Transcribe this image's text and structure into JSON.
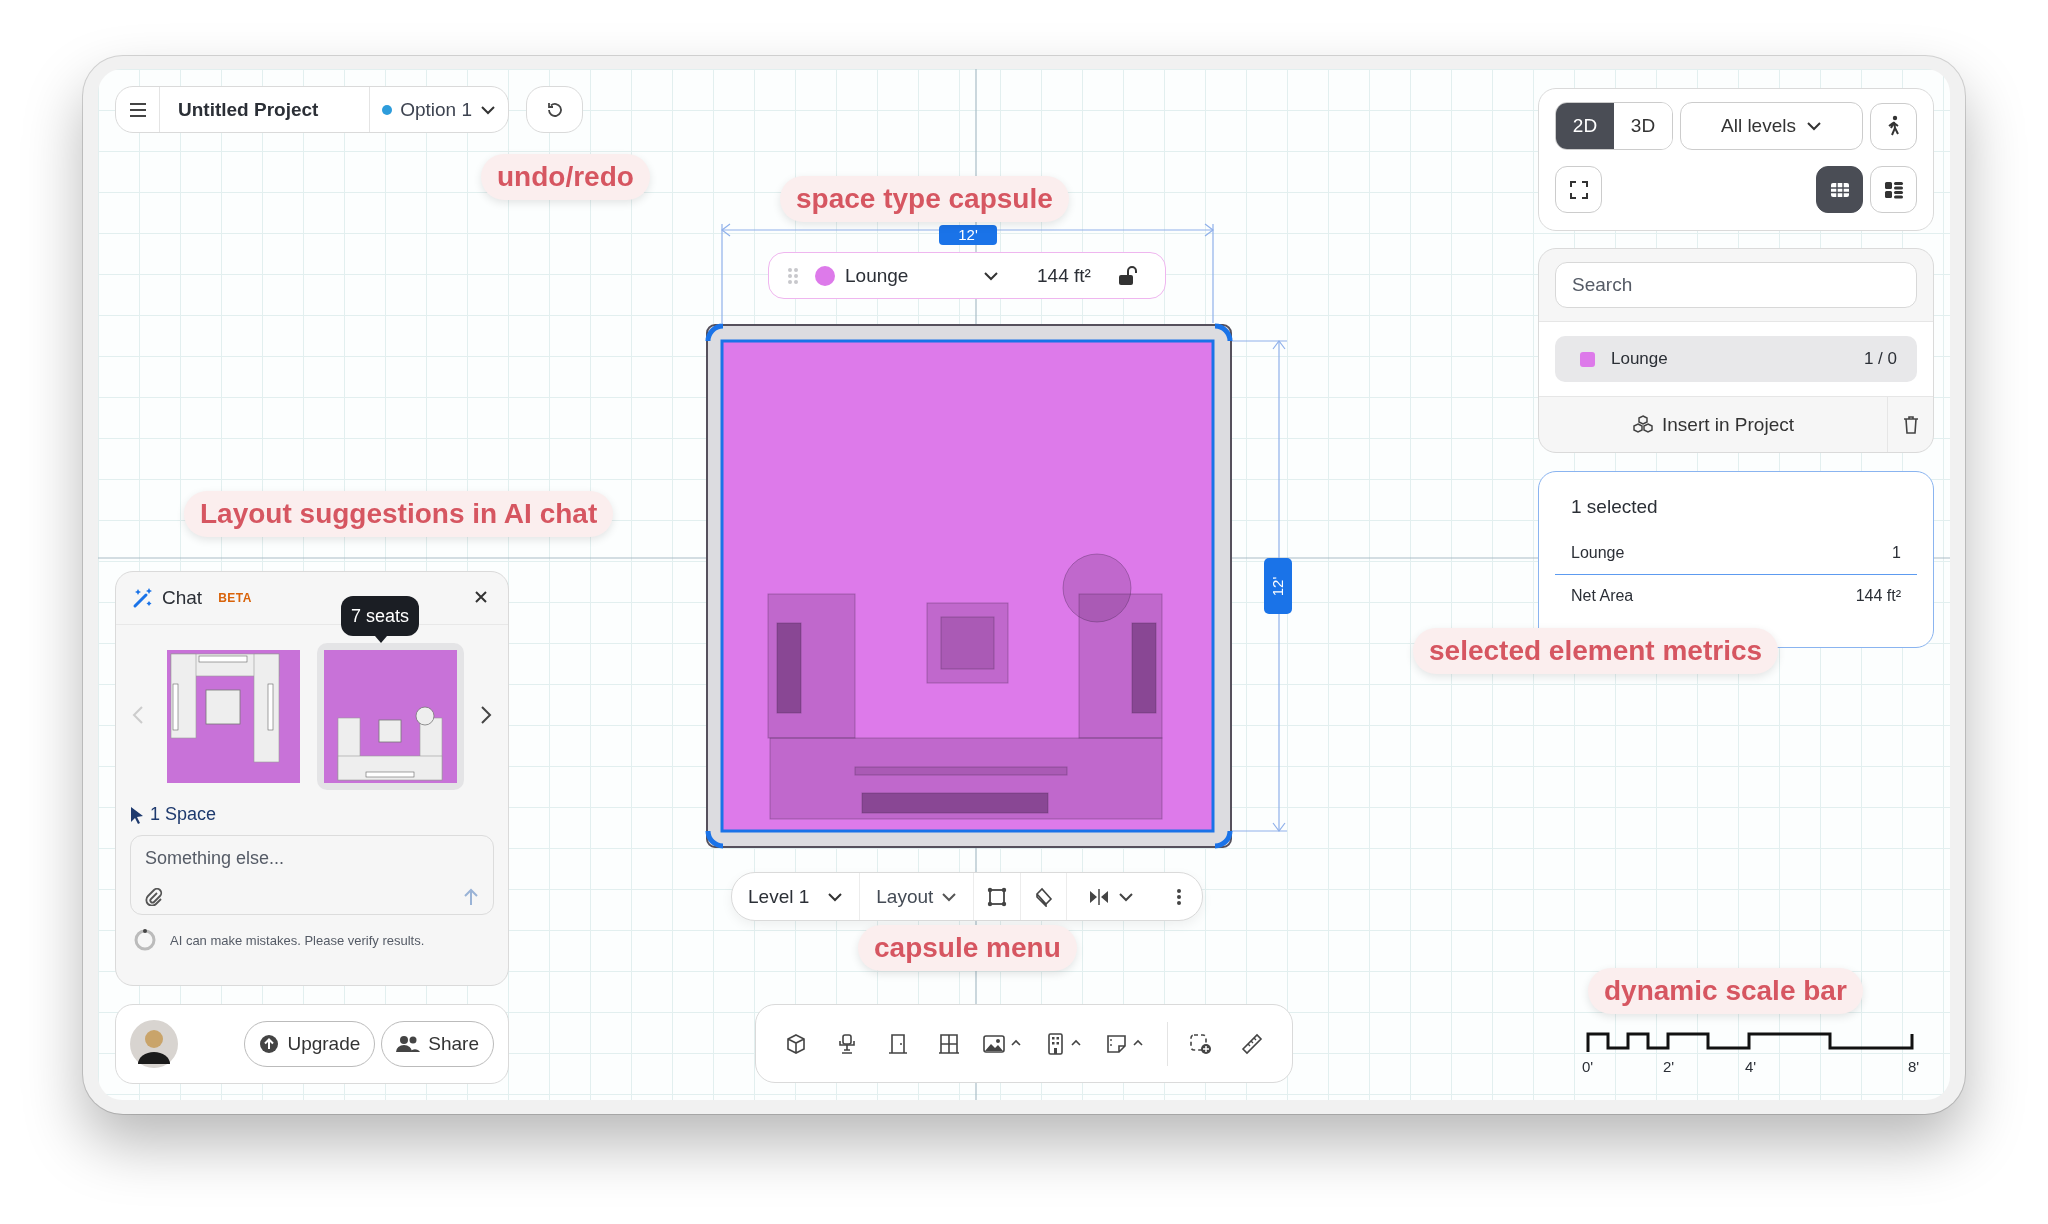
{
  "header": {
    "title": "Untitled Project",
    "option": "Option 1"
  },
  "annotations": [
    {
      "text": "undo/redo"
    },
    {
      "text": "space type capsule"
    },
    {
      "text": "Layout suggestions in AI chat"
    },
    {
      "text": "capsule menu"
    },
    {
      "text": "selected element metrics"
    },
    {
      "text": "dynamic scale bar"
    }
  ],
  "space_capsule": {
    "space_type": "Lounge",
    "color": "#dd7aea",
    "area": "144 ft²",
    "locked": false
  },
  "dimensions": {
    "width": "12'",
    "depth": "12'"
  },
  "view_panel": {
    "modes": [
      {
        "label": "2D",
        "selected": true
      },
      {
        "label": "3D",
        "selected": false
      }
    ],
    "level_filter": "All levels",
    "layouts": [
      {
        "kind": "grid",
        "selected": true
      },
      {
        "kind": "list",
        "selected": false
      }
    ]
  },
  "library": {
    "search_placeholder": "Search",
    "items": [
      {
        "name": "Lounge",
        "color": "#dd7aea",
        "count": "1 / 0",
        "selected": true
      }
    ],
    "insert_label": "Insert in Project"
  },
  "selection": {
    "title": "1 selected",
    "rows": [
      {
        "label": "Lounge",
        "value": "1"
      },
      {
        "label": "Net Area",
        "value": "144 ft²"
      }
    ]
  },
  "chat": {
    "title": "Chat",
    "badge": "BETA",
    "previous_disabled": true,
    "suggestions": [
      {
        "selected": false
      },
      {
        "selected": true,
        "tooltip": "7 seats"
      }
    ],
    "context": "1 Space",
    "placeholder": "Something else...",
    "disclaimer": "AI can make mistakes. Please verify results."
  },
  "account": {
    "buttons": [
      {
        "kind": "upgrade",
        "label": "Upgrade"
      },
      {
        "kind": "share",
        "label": "Share"
      }
    ]
  },
  "capsule_menu": {
    "level": "Level 1",
    "mode": "Layout"
  },
  "scale_bar": {
    "labels": [
      "0'",
      "2'",
      "4'",
      "8'"
    ]
  }
}
